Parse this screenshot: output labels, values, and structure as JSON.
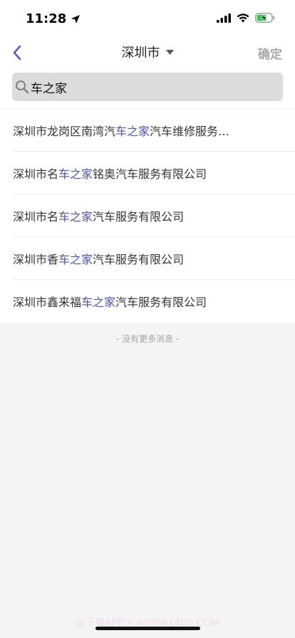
{
  "status_bar": {
    "time": "11:28"
  },
  "nav": {
    "title": "深圳市",
    "confirm_label": "确定"
  },
  "search": {
    "value": "车之家"
  },
  "results": [
    {
      "before": "深圳市龙岗区南湾汽",
      "highlight": "车之家",
      "after": "汽车维修服务…"
    },
    {
      "before": "深圳市名",
      "highlight": "车之家",
      "after": "铭奥汽车服务有限公司"
    },
    {
      "before": "深圳市名",
      "highlight": "车之家",
      "after": "汽车服务有限公司"
    },
    {
      "before": "深圳市香",
      "highlight": "车之家",
      "after": "汽车服务有限公司"
    },
    {
      "before": "深圳市鑫来福",
      "highlight": "车之家",
      "after": "汽车服务有限公司"
    }
  ],
  "footer_note": "- 没有更多消息 -",
  "watermark": "@下载APP • 400881400.COM",
  "colors": {
    "highlight": "#4b4fc4",
    "back_arrow": "#5a5ad6",
    "confirm": "#a8a8a8"
  }
}
